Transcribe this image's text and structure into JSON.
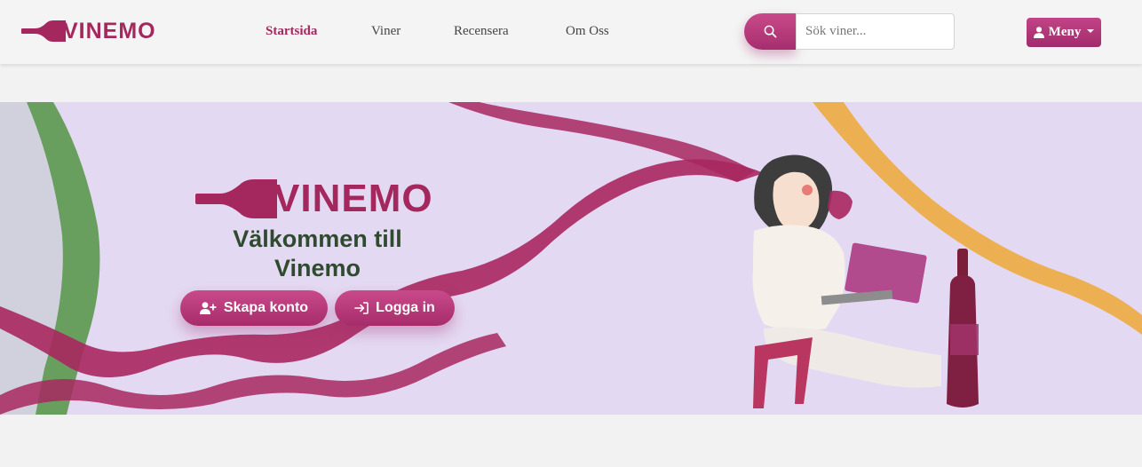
{
  "brand": {
    "name": "VINEMO"
  },
  "nav": {
    "links": [
      {
        "label": "Startsida",
        "active": true
      },
      {
        "label": "Viner",
        "active": false
      },
      {
        "label": "Recensera",
        "active": false
      },
      {
        "label": "Om Oss",
        "active": false
      }
    ]
  },
  "search": {
    "placeholder": "Sök viner...",
    "icon": "search-icon"
  },
  "menu": {
    "label": "Meny",
    "icon": "user-icon"
  },
  "hero": {
    "logo_text": "VINEMO",
    "title_line1": "Välkommen till",
    "title_line2": "Vinemo",
    "create_account_label": "Skapa konto",
    "create_account_icon": "user-plus-icon",
    "login_label": "Logga in",
    "login_icon": "login-icon"
  },
  "colors": {
    "brand": "#a4275d",
    "accent_gradient_top": "#c94a8a",
    "accent_gradient_bottom": "#a62c6c",
    "hero_background": "#e4d9f3",
    "title_green": "#2f4a2f",
    "active_nav": "#a4275d"
  }
}
